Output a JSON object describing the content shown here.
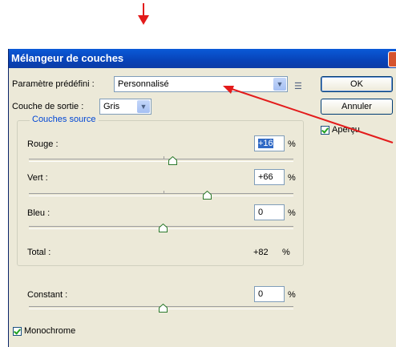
{
  "dialog": {
    "title": "Mélangeur de couches"
  },
  "preset": {
    "label": "Paramètre prédéfini :",
    "value": "Personnalisé"
  },
  "output": {
    "label": "Couche de sortie :",
    "value": "Gris"
  },
  "buttons": {
    "ok": "OK",
    "cancel": "Annuler"
  },
  "preview": {
    "label": "Aperçu",
    "checked": true
  },
  "source": {
    "title": "Couches source",
    "red": {
      "label": "Rouge :",
      "value": "+16",
      "unit": "%"
    },
    "green": {
      "label": "Vert :",
      "value": "+66",
      "unit": "%"
    },
    "blue": {
      "label": "Bleu :",
      "value": "0",
      "unit": "%"
    },
    "total": {
      "label": "Total :",
      "value": "+82",
      "unit": "%"
    }
  },
  "constant": {
    "label": "Constant :",
    "value": "0",
    "unit": "%"
  },
  "monochrome": {
    "label": "Monochrome",
    "checked": true
  },
  "colors": {
    "titlebar": "#0843b8",
    "annotation": "#e31b1b",
    "group_title": "#0046d5"
  }
}
